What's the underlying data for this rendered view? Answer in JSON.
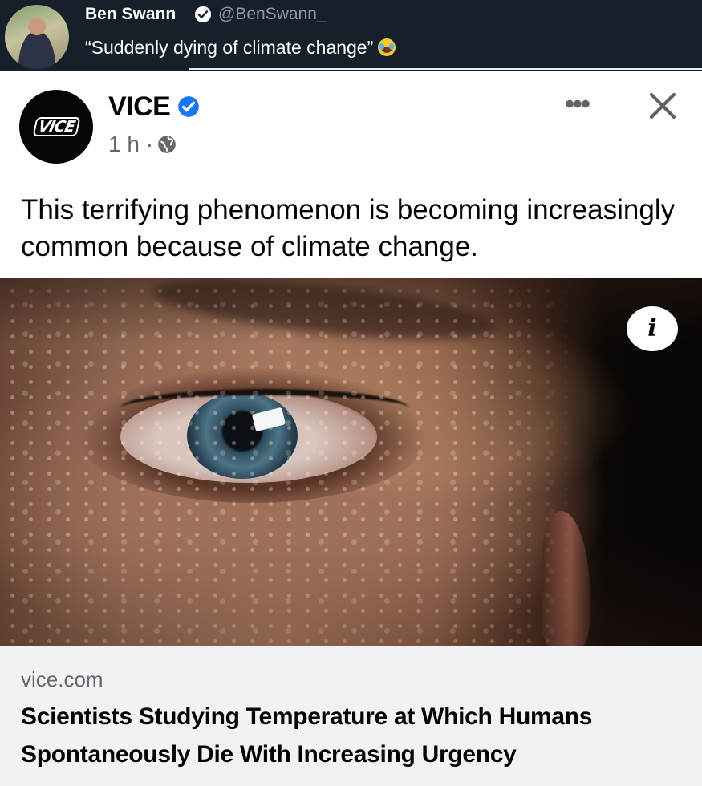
{
  "tweet": {
    "author_name": "Ben Swann",
    "author_handle": "@BenSwann_",
    "text": "“Suddenly dying of climate change”",
    "emoji_icon": "face-with-tears-of-joy-icon"
  },
  "post": {
    "page_name": "VICE",
    "logo_text": "VICE",
    "timestamp": "1 h ·",
    "caption": "This terrifying phenomenon is becoming increasingly common because of climate change.",
    "more_icon": "•••",
    "verified_color": "#1877f2"
  },
  "link_preview": {
    "domain": "vice.com",
    "title": "Scientists Studying Temperature at Which Humans Spontaneously Die With Increasing Urgency"
  },
  "image": {
    "info_label": "i"
  }
}
